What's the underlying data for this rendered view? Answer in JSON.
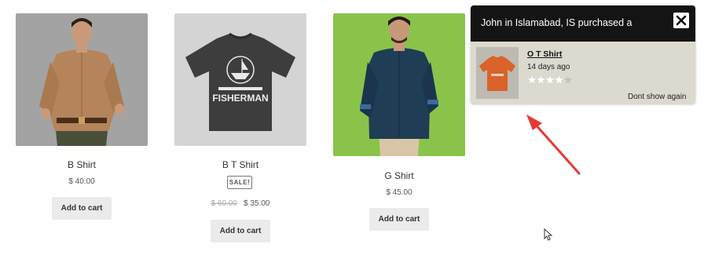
{
  "products": [
    {
      "title": "B Shirt",
      "price": "$ 40.00",
      "button": "Add to cart"
    },
    {
      "title": "B T Shirt",
      "sale_badge": "SALE!",
      "old_price": "$ 60.00",
      "price": "$ 35.00",
      "button": "Add to cart",
      "print_text": "FISHERMAN"
    },
    {
      "title": "G Shirt",
      "price": "$ 45.00",
      "button": "Add to cart"
    }
  ],
  "popup": {
    "headline": "John in Islamabad, IS purchased a",
    "product_name": "O T Shirt",
    "time_ago": "14 days ago",
    "rating": 4,
    "rating_max": 5,
    "dismiss_label": "Dont show again",
    "close_icon": "close-icon"
  },
  "colors": {
    "popup_header": "#141414",
    "popup_body": "#dcd9cf",
    "arrow": "#e53935",
    "gshirt_bg": "#8bc34a"
  }
}
